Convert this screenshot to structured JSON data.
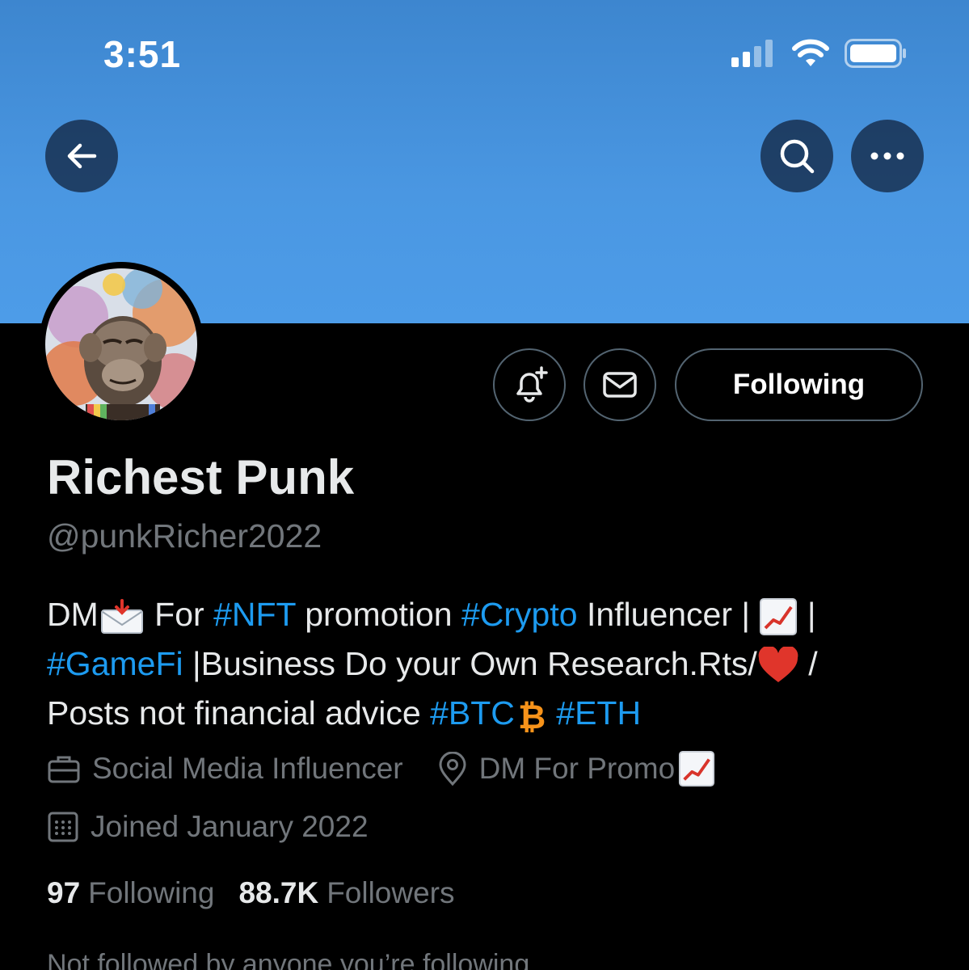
{
  "status_bar": {
    "time": "3:51"
  },
  "profile": {
    "display_name": "Richest Punk",
    "handle": "@punkRicher2022",
    "following_button_label": "Following",
    "bio": {
      "line1_a": "DM",
      "line1_b": "For",
      "tag_nft": "#NFT",
      "line1_c": "promotion",
      "tag_crypto": "#Crypto",
      "line1_d": "Influencer |",
      "line1_e": "|",
      "tag_gamefi": "#GameFi",
      "line2_a": "|Business Do your Own Research.Rts/",
      "line2_b": "/",
      "line3_a": "Posts not financial advice",
      "tag_btc": "#BTC",
      "tag_eth": "#ETH"
    },
    "occupation": "Social Media Influencer",
    "location": "DM For Promo",
    "joined": "Joined January 2022",
    "following_count": "97",
    "following_label": "Following",
    "followers_count": "88.7K",
    "followers_label": "Followers",
    "mutual_note": "Not followed by anyone you’re following"
  },
  "colors": {
    "accent": "#1d9bf0",
    "muted": "#71767b",
    "banner": "#4a97e2"
  }
}
